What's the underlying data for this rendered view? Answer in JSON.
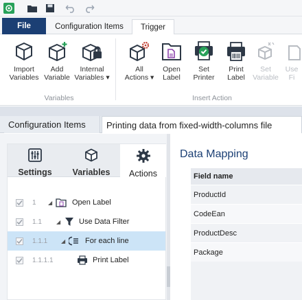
{
  "quick_access": {
    "icons": [
      "app-logo-icon",
      "open-folder-icon",
      "save-icon",
      "undo-icon",
      "redo-icon"
    ]
  },
  "ribbon_tabs": {
    "file": "File",
    "configuration_items": "Configuration Items",
    "trigger": "Trigger"
  },
  "ribbon": {
    "variables_group": {
      "label": "Variables",
      "import_variables": "Import\nVariables",
      "add_variable": "Add\nVariable",
      "internal_variables": "Internal\nVariables ▾"
    },
    "insert_action_group": {
      "label": "Insert Action",
      "all_actions": "All\nActions ▾",
      "open_label": "Open\nLabel",
      "set_printer": "Set\nPrinter",
      "print_label": "Print\nLabel",
      "set_variable": "Set\nVariable",
      "use_file": "Use\nFi"
    }
  },
  "document_tabs": {
    "configuration_items": "Configuration Items",
    "current": "Printing data from fixed-width-columns file"
  },
  "left_panel": {
    "tabs": {
      "settings": "Settings",
      "variables": "Variables",
      "actions": "Actions"
    },
    "tree": [
      {
        "num": "1",
        "label": "Open Label"
      },
      {
        "num": "1.1",
        "label": "Use Data Filter"
      },
      {
        "num": "1.1.1",
        "label": "For each line"
      },
      {
        "num": "1.1.1.1",
        "label": "Print Label"
      }
    ]
  },
  "data_mapping": {
    "title": "Data Mapping",
    "column_header": "Field name",
    "rows": [
      "ProductId",
      "CodeEan",
      "ProductDesc",
      "Package"
    ]
  },
  "colors": {
    "accent": "#1b3f74",
    "selection": "#cce4f7",
    "brand_green": "#28a15a"
  }
}
